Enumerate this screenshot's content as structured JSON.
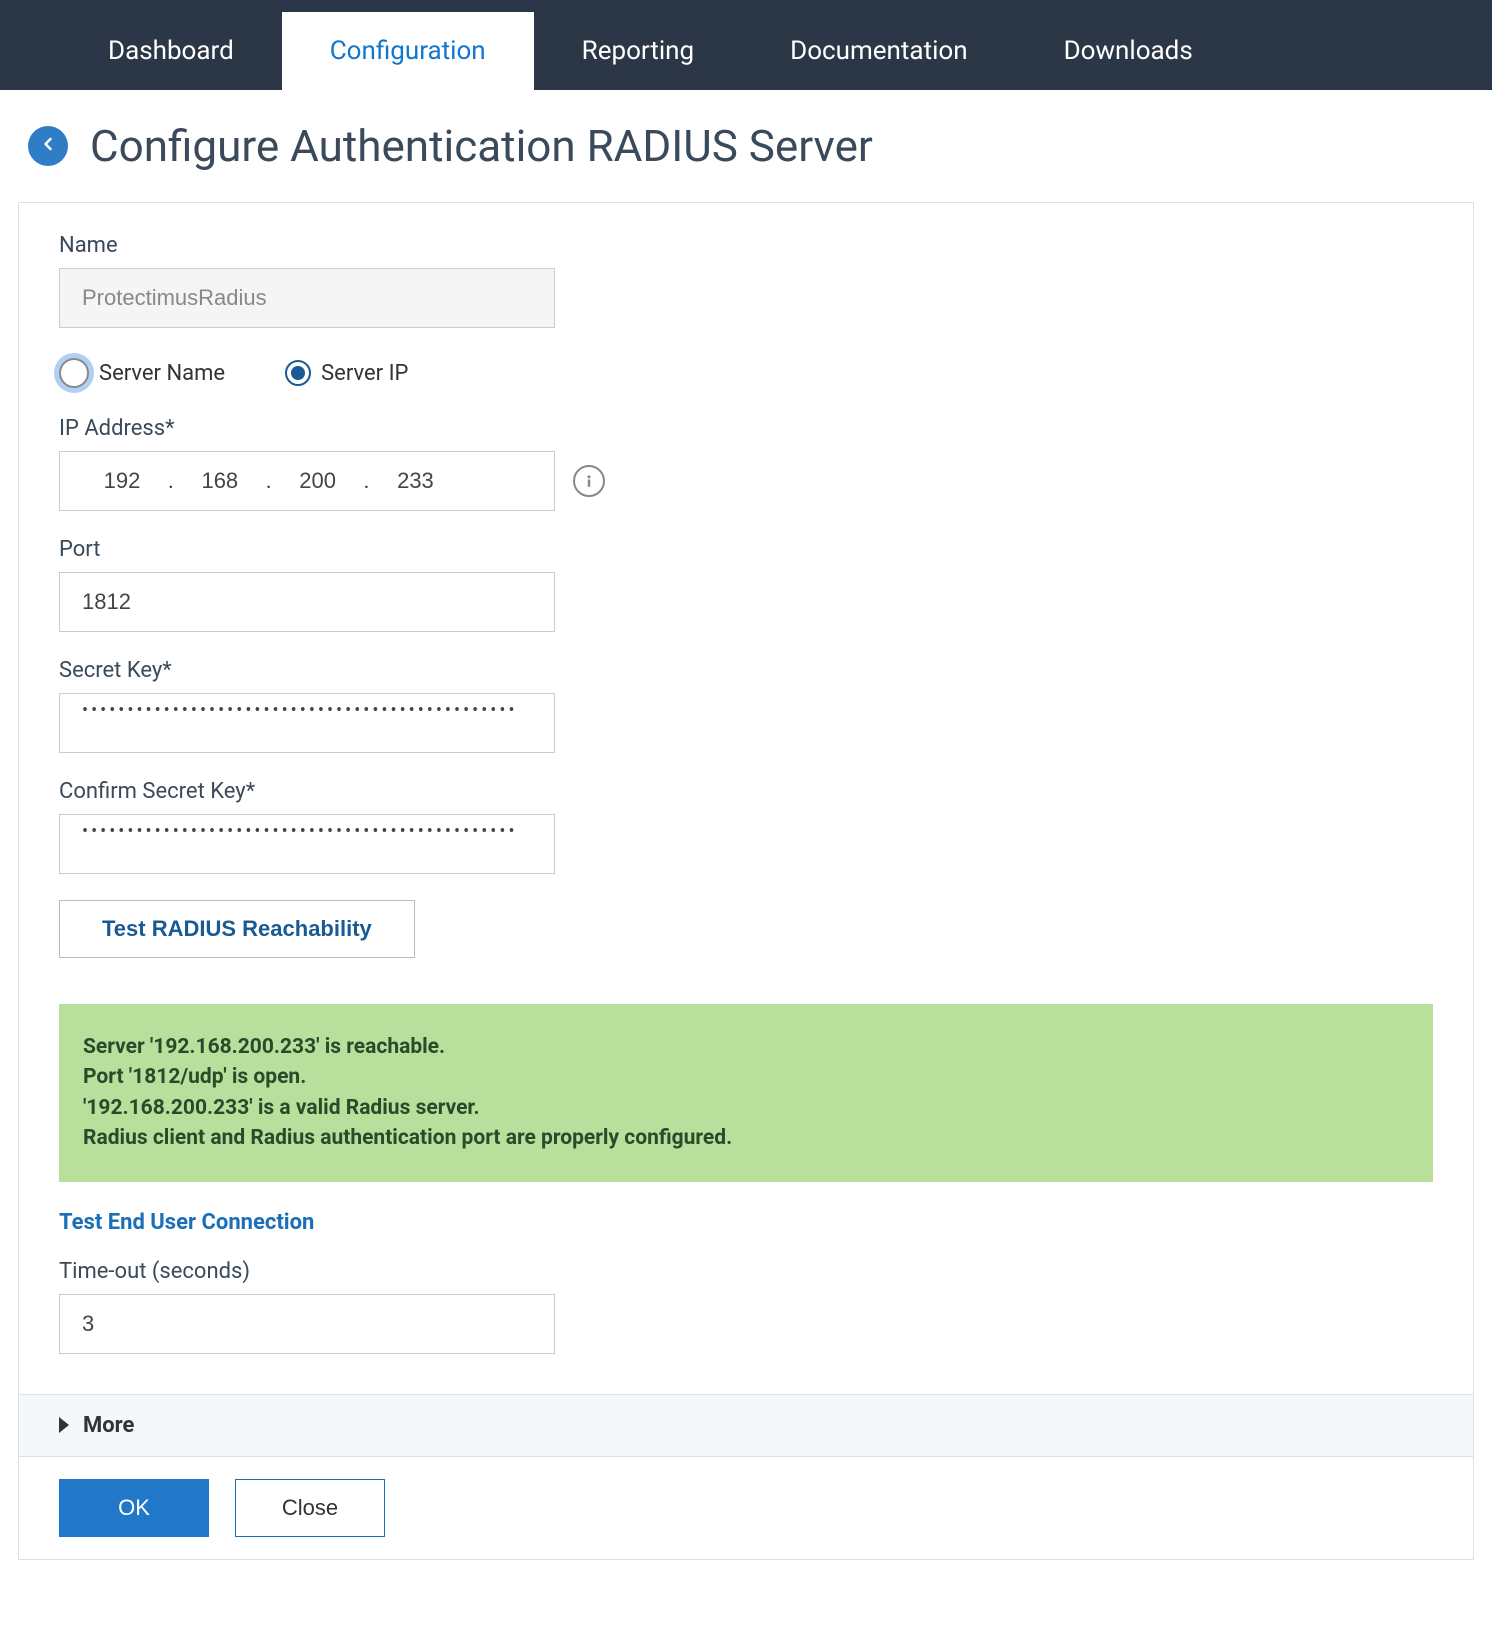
{
  "nav": {
    "items": [
      {
        "label": "Dashboard"
      },
      {
        "label": "Configuration"
      },
      {
        "label": "Reporting"
      },
      {
        "label": "Documentation"
      },
      {
        "label": "Downloads"
      }
    ],
    "active_index": 1
  },
  "page": {
    "title": "Configure Authentication RADIUS Server"
  },
  "form": {
    "name_label": "Name",
    "name_value": "ProtectimusRadius",
    "radio_server_name": "Server Name",
    "radio_server_ip": "Server IP",
    "radio_selected": "ip",
    "ip_label": "IP Address*",
    "ip_octets": [
      "192",
      "168",
      "200",
      "233"
    ],
    "port_label": "Port",
    "port_value": "1812",
    "secret_label": "Secret Key*",
    "secret_masked": "••••••••••••••••••••••••••••••••••••••••••••••••",
    "confirm_label": "Confirm Secret Key*",
    "confirm_masked": "••••••••••••••••••••••••••••••••••••••••••••••••",
    "test_button": "Test RADIUS Reachability",
    "status_lines": [
      "Server '192.168.200.233' is reachable.",
      "Port '1812/udp' is open.",
      "'192.168.200.233' is a valid Radius server.",
      "Radius client and Radius authentication port are properly configured."
    ],
    "test_end_user_link": "Test End User Connection",
    "timeout_label": "Time-out (seconds)",
    "timeout_value": "3",
    "more_label": "More"
  },
  "footer": {
    "ok": "OK",
    "close": "Close"
  }
}
